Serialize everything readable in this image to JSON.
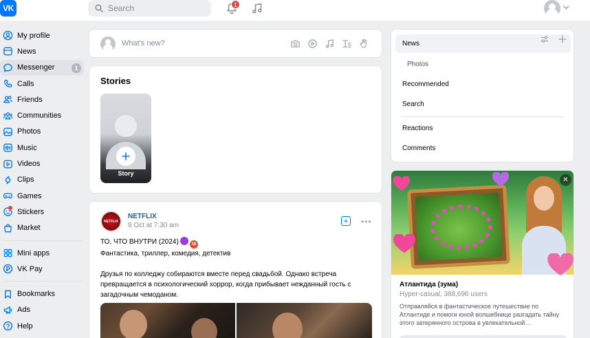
{
  "header": {
    "logo_text": "VK",
    "search_placeholder": "Search",
    "notifications_count": "1"
  },
  "sidebar": {
    "items": [
      {
        "label": "My profile",
        "icon": "user-circle-icon"
      },
      {
        "label": "News",
        "icon": "news-icon"
      },
      {
        "label": "Messenger",
        "icon": "chat-bubble-icon",
        "badge": "1",
        "active": true
      },
      {
        "label": "Calls",
        "icon": "phone-icon"
      },
      {
        "label": "Friends",
        "icon": "friends-icon"
      },
      {
        "label": "Communities",
        "icon": "communities-icon"
      },
      {
        "label": "Photos",
        "icon": "photo-icon"
      },
      {
        "label": "Music",
        "icon": "music-icon"
      },
      {
        "label": "Videos",
        "icon": "video-icon"
      },
      {
        "label": "Clips",
        "icon": "clips-icon"
      },
      {
        "label": "Games",
        "icon": "gamepad-icon"
      },
      {
        "label": "Stickers",
        "icon": "sticker-icon"
      },
      {
        "label": "Market",
        "icon": "market-bag-icon"
      }
    ],
    "items2": [
      {
        "label": "Mini apps",
        "icon": "mini-apps-icon"
      },
      {
        "label": "VK Pay",
        "icon": "vk-pay-icon"
      }
    ],
    "items3": [
      {
        "label": "Bookmarks",
        "icon": "bookmark-icon"
      },
      {
        "label": "Ads",
        "icon": "megaphone-icon"
      },
      {
        "label": "Help",
        "icon": "help-icon"
      }
    ]
  },
  "composer": {
    "placeholder": "What's new?"
  },
  "stories": {
    "title": "Stories",
    "create_label": "Story"
  },
  "post": {
    "author": "NETFLIX",
    "avatar_text": "NETFLIX",
    "date": "9 Oct at 7:30 am",
    "line1": "ТО, ЧТО ВНУТРИ (2024)",
    "age_badge": "18",
    "line2": "Фантастика, триллер, комедия, детектив",
    "body": "Друзья по колледжу собираются вместе перед свадьбой. Однако встреча превращается в психологический хоррор, когда прибывает нежданный гость с загадочным чемоданом."
  },
  "right_nav": {
    "items": [
      "News",
      "Photos",
      "Recommended",
      "Search"
    ],
    "items2": [
      "Reactions",
      "Comments"
    ]
  },
  "ad": {
    "title": "Атлантида (зума)",
    "subtitle": "Hyper-casual, 388,696 users",
    "description": "Отправляйся в фантастическое путешествие по Атлантиде и помоги юной волшебнице разгадать тайну этого затерянного острова в увлекательной…"
  },
  "colors": {
    "accent": "#0077ff",
    "background": "#edeef0",
    "badge_red": "#e64646",
    "link": "#2a5885"
  }
}
